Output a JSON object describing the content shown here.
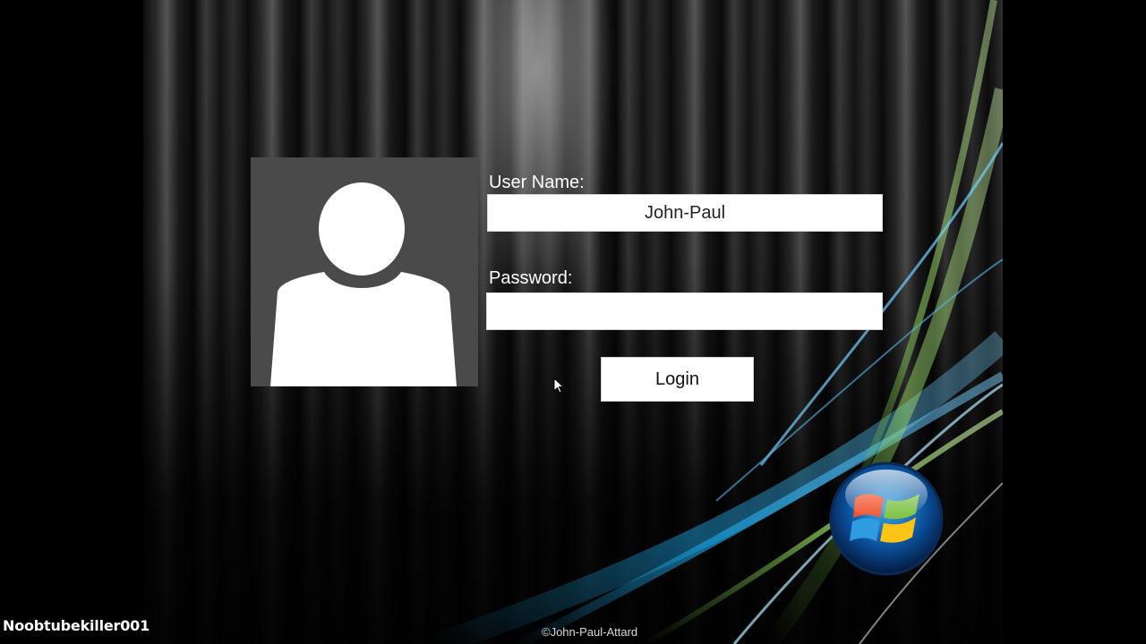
{
  "login": {
    "username_label": "User Name:",
    "username_value": "John-Paul",
    "password_label": "Password:",
    "password_value": "",
    "login_button": "Login"
  },
  "footer": {
    "watermark": "Noobtubekiller001",
    "copyright": "©John-Paul-Attard"
  },
  "icons": {
    "avatar": "user-silhouette-icon",
    "logo": "windows-logo-icon",
    "cursor": "mouse-pointer-icon"
  },
  "colors": {
    "avatar_tile": "#4a4a4a",
    "field_background": "#ffffff",
    "label_text": "#ffffff",
    "background": "#000000"
  }
}
